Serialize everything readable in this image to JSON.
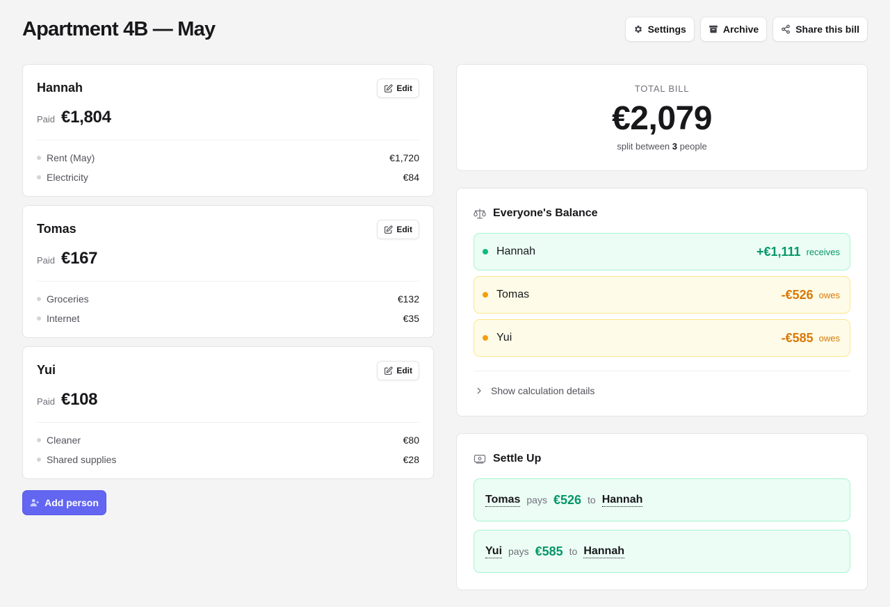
{
  "header": {
    "title": "Apartment 4B — May",
    "settings_label": "Settings",
    "archive_label": "Archive",
    "share_label": "Share this bill"
  },
  "people": [
    {
      "name": "Hannah",
      "paid_label": "Paid",
      "paid": "€1,804",
      "edit_label": "Edit",
      "expenses": [
        {
          "label": "Rent (May)",
          "amount": "€1,720"
        },
        {
          "label": "Electricity",
          "amount": "€84"
        }
      ]
    },
    {
      "name": "Tomas",
      "paid_label": "Paid",
      "paid": "€167",
      "edit_label": "Edit",
      "expenses": [
        {
          "label": "Groceries",
          "amount": "€132"
        },
        {
          "label": "Internet",
          "amount": "€35"
        }
      ]
    },
    {
      "name": "Yui",
      "paid_label": "Paid",
      "paid": "€108",
      "edit_label": "Edit",
      "expenses": [
        {
          "label": "Cleaner",
          "amount": "€80"
        },
        {
          "label": "Shared supplies",
          "amount": "€28"
        }
      ]
    }
  ],
  "add_person_label": "Add person",
  "total": {
    "label": "TOTAL BILL",
    "amount": "€2,079",
    "sub_prefix": "split between",
    "count": "3",
    "sub_suffix": "people"
  },
  "balance": {
    "title": "Everyone's Balance",
    "rows": [
      {
        "name": "Hannah",
        "amount": "+€1,111",
        "tag": "receives",
        "status": "positive"
      },
      {
        "name": "Tomas",
        "amount": "-€526",
        "tag": "owes",
        "status": "negative"
      },
      {
        "name": "Yui",
        "amount": "-€585",
        "tag": "owes",
        "status": "negative"
      }
    ],
    "details_label": "Show calculation details"
  },
  "settle": {
    "title": "Settle Up",
    "rows": [
      {
        "from": "Tomas",
        "verb": "pays",
        "amount": "€526",
        "to_word": "to",
        "to": "Hannah"
      },
      {
        "from": "Yui",
        "verb": "pays",
        "amount": "€585",
        "to_word": "to",
        "to": "Hannah"
      }
    ]
  },
  "icons": {
    "settings": "gear-icon",
    "archive": "archive-box-icon",
    "share": "share-icon",
    "edit": "pencil-square-icon",
    "add_person": "user-plus-icon",
    "balance": "scale-icon",
    "settle": "banknote-icon",
    "details": "chevron-right-icon"
  },
  "colors": {
    "accent": "#6366f1",
    "positive": "#059669",
    "negative": "#d97706",
    "positive_bg": "#ecfdf5",
    "negative_bg": "#fefce8"
  }
}
